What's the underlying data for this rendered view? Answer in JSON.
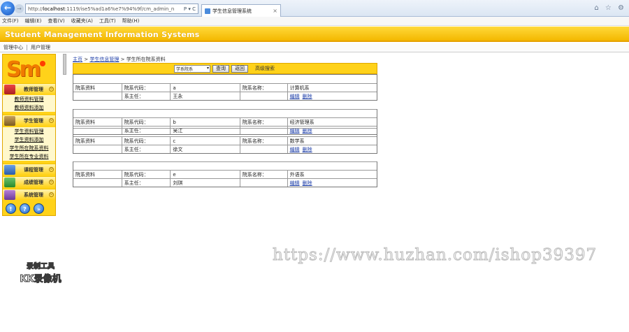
{
  "browser": {
    "address_prefix": "http://",
    "address_host": "localhost",
    "address_rest": ":1119/ise5%ad1a6%e7%94%9f/cm_admin_n",
    "addr_controls": "P ▾ C",
    "tab_label": "学生信息管理系统",
    "tab_close": "×",
    "menu": [
      "文件(F)",
      "编辑(E)",
      "查看(V)",
      "收藏夹(A)",
      "工具(T)",
      "帮助(H)"
    ],
    "window_icons": "⌂ ☆ ⚙"
  },
  "app": {
    "title": "Student Management Information Systems",
    "toolbar": [
      "管理中心",
      "用户管理"
    ]
  },
  "sidebar": {
    "logo": "Sm",
    "sections": [
      {
        "label": "教师管理",
        "items": [
          "教师资料管理",
          "教师资料添加"
        ]
      },
      {
        "label": "学生管理",
        "items": [
          "学生资料管理",
          "学生资料添加",
          "学生所在院系资料",
          "学生所在专业资料"
        ]
      },
      {
        "label": "课程管理",
        "items": []
      },
      {
        "label": "成绩管理",
        "items": []
      },
      {
        "label": "系统管理",
        "items": []
      }
    ],
    "toggle": "⊙",
    "bottom_buttons": [
      "!",
      "?",
      "»"
    ]
  },
  "main": {
    "breadcrumb": {
      "home": "主页",
      "sep": ">",
      "section": "学生信息管理",
      "current": "学生所在院系资料"
    },
    "search": {
      "select_value": "学系院系",
      "search_label": "查询",
      "back_label": "返回",
      "advanced_label": "高级搜索"
    },
    "labels": {
      "record": "院系资料",
      "code": "院系代码：",
      "name": "院系名称：",
      "head": "系主任：",
      "edit": "编辑",
      "delete": "删除"
    },
    "records": [
      {
        "code": "a",
        "name": "计算机系",
        "head": "王永"
      },
      {
        "code": "b",
        "name": "经济管理系",
        "head": "吴江"
      },
      {
        "code": "c",
        "name": "数学系",
        "head": "徐文"
      },
      {
        "code": "e",
        "name": "外语系",
        "head": "刘琪"
      }
    ]
  },
  "overlay": {
    "watermark": "https://www.huzhan.com/ishop39397",
    "recorder_line1": "录制工具",
    "recorder_line2": "KK录像机"
  }
}
